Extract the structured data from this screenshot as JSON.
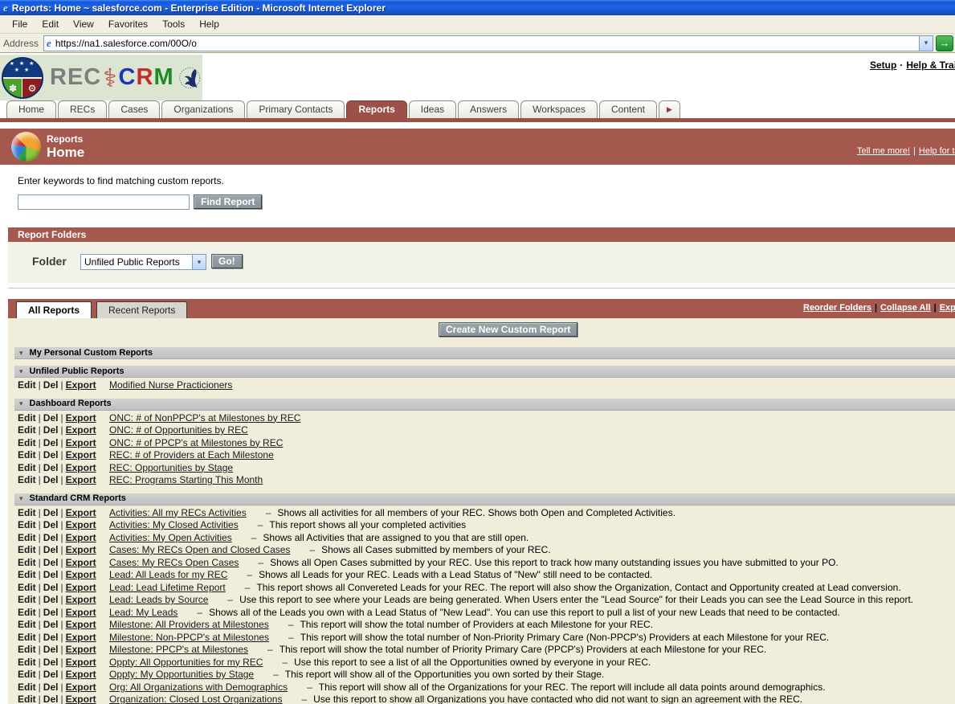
{
  "colors": {
    "brand_red": "#A5584E",
    "tab_selected_red": "#9E4F47",
    "content_cream": "#F0EDDA",
    "section_bar_gray": "#C8C8C8",
    "button_gray": "#909BA2",
    "go_button_green": "#2E9E40",
    "titlebar_blue": "#1658D8",
    "logo_band_green": "#DCE5D2"
  },
  "icons": {
    "more_tabs": "▶",
    "dropdown_chevron": "▾",
    "go_arrow": "→",
    "section_collapse": "▾",
    "ie_e": "e",
    "caduceus": "⚕",
    "logo_stars_row1": "★ ★ ★",
    "logo_stars_row2": "★ ★",
    "logo_plant": "✽",
    "logo_gear": "⚙"
  },
  "window": {
    "title": "Reports: Home ~ salesforce.com - Enterprise Edition - Microsoft Internet Explorer",
    "menu_items": [
      "File",
      "Edit",
      "View",
      "Favorites",
      "Tools",
      "Help"
    ],
    "address_label": "Address",
    "address_url": "https://na1.salesforce.com/00O/o"
  },
  "branding": {
    "rec_logo_text": "REC",
    "crm": {
      "c": "C",
      "r": "R",
      "m": "M"
    },
    "setup_link": "Setup",
    "separator": "·",
    "help_training_link": "Help & Training"
  },
  "nav_tabs": [
    {
      "label": "Home",
      "selected": false
    },
    {
      "label": "RECs",
      "selected": false
    },
    {
      "label": "Cases",
      "selected": false
    },
    {
      "label": "Organizations",
      "selected": false
    },
    {
      "label": "Primary Contacts",
      "selected": false
    },
    {
      "label": "Reports",
      "selected": true
    },
    {
      "label": "Ideas",
      "selected": false
    },
    {
      "label": "Answers",
      "selected": false
    },
    {
      "label": "Workspaces",
      "selected": false
    },
    {
      "label": "Content",
      "selected": false
    }
  ],
  "page_header": {
    "section": "Reports",
    "title": "Home",
    "links": [
      "Tell me more!",
      "Help for this Page"
    ]
  },
  "search": {
    "prompt": "Enter keywords to find matching custom reports.",
    "input_value": "",
    "button_label": "Find Report"
  },
  "report_folders": {
    "title": "Report Folders",
    "folder_label": "Folder",
    "selected_folder": "Unfiled Public Reports",
    "go_button_label": "Go!"
  },
  "reports_panel": {
    "tabs": [
      {
        "label": "All Reports",
        "selected": true
      },
      {
        "label": "Recent Reports",
        "selected": false
      }
    ],
    "links": [
      "Reorder Folders",
      "Collapse All",
      "Expand All"
    ],
    "create_button_label": "Create New Custom Report",
    "row_actions": [
      "Edit",
      "Del",
      "Export"
    ],
    "sections": [
      {
        "title": "My Personal Custom Reports",
        "rows": []
      },
      {
        "title": "Unfiled Public Reports",
        "rows": [
          {
            "name": "Modified Nurse Practicioners",
            "description": ""
          }
        ]
      },
      {
        "title": "Dashboard Reports",
        "rows": [
          {
            "name": "ONC: # of NonPPCP's at Milestones by REC",
            "description": ""
          },
          {
            "name": "ONC: # of Opportunities by REC",
            "description": ""
          },
          {
            "name": "ONC: # of PPCP's at Milestones by REC",
            "description": ""
          },
          {
            "name": "REC: # of Providers at Each Milestone",
            "description": ""
          },
          {
            "name": "REC: Opportunities by Stage",
            "description": ""
          },
          {
            "name": "REC: Programs Starting This Month",
            "description": ""
          }
        ]
      },
      {
        "title": "Standard CRM Reports",
        "rows": [
          {
            "name": "Activities: All my RECs Activities",
            "description": "Shows all activities for all members of your REC. Shows both Open and Completed Activities."
          },
          {
            "name": "Activities: My Closed Activities",
            "description": "This report shows all your completed activities"
          },
          {
            "name": "Activities: My Open Activities",
            "description": "Shows all Activities that are assigned to you that are still open."
          },
          {
            "name": "Cases: My RECs Open and Closed Cases",
            "description": "Shows all Cases submitted by members of your REC."
          },
          {
            "name": "Cases: My RECs Open Cases",
            "description": "Shows all Open Cases submitted by your REC. Use this report to track how many outstanding issues you have submitted to your PO."
          },
          {
            "name": "Lead: All Leads for my REC",
            "description": "Shows all Leads for your REC. Leads with a Lead Status of \"New\" still need to be contacted."
          },
          {
            "name": "Lead: Lead Lifetime Report",
            "description": "This report shows all Convereted Leads for your REC. The report will also show the Organization, Contact and Opportunity created at Lead conversion."
          },
          {
            "name": "Lead: Leads by Source",
            "description": "Use this report to see where your Leads are being generated. When Users enter the \"Lead Source\" for their Leads you can see the Lead Source in this report."
          },
          {
            "name": "Lead: My Leads",
            "description": "Shows all of the Leads you own with a Lead Status of \"New Lead\". You can use this report to pull a list of your new Leads that need to be contacted."
          },
          {
            "name": "Milestone: All Providers at Milestones",
            "description": "This report will show the total number of Providers at each Milestone for your REC."
          },
          {
            "name": "Milestone: Non-PPCP's at Milestones",
            "description": "This report will show the total number of Non-Priority Primary Care (Non-PPCP's) Providers at each Milestone for your REC."
          },
          {
            "name": "Milestone: PPCP's at Milestones",
            "description": "This report will show the total number of Priority Primary Care (PPCP's) Providers at each Milestone for your REC."
          },
          {
            "name": "Oppty: All Opportunities for my REC",
            "description": "Use this report to see a list of all the Opportunities owned by everyone in your REC."
          },
          {
            "name": "Oppty: My Opportunities by Stage",
            "description": "This report will show all of the Opportunities you own sorted by their Stage."
          },
          {
            "name": "Org: All Organizations with Demographics",
            "description": "This report will show all of the Organizations for your REC. The report will include all data points around demographics."
          },
          {
            "name": "Organization: Closed Lost Organizations",
            "description": "Use this report to show all Organizations you have contacted who did not want to sign an agreement with the REC."
          }
        ]
      }
    ]
  }
}
